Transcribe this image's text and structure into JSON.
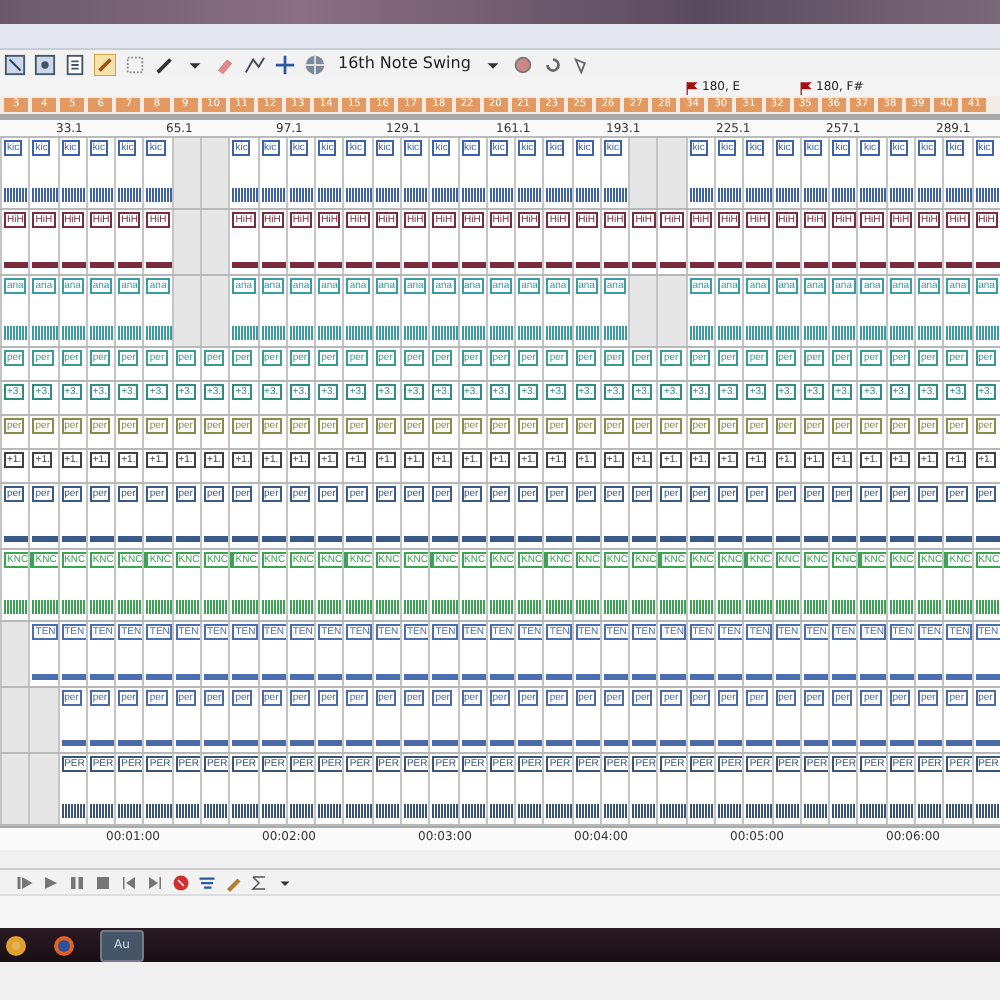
{
  "toolbar": {
    "swing": "16th Note Swing"
  },
  "markers": [
    {
      "label": "180, E"
    },
    {
      "label": "180, F#"
    }
  ],
  "sections": [
    "3",
    "4",
    "5",
    "6",
    "7",
    "8",
    "9",
    "10",
    "11",
    "12",
    "13",
    "14",
    "15",
    "16",
    "17",
    "18",
    "22",
    "20",
    "21",
    "23",
    "25",
    "26",
    "27",
    "28",
    "34",
    "30",
    "31",
    "32",
    "35",
    "36",
    "37",
    "38",
    "39",
    "40",
    "41"
  ],
  "bar_ruler": [
    "33.1",
    "65.1",
    "97.1",
    "129.1",
    "161.1",
    "193.1",
    "225.1",
    "257.1",
    "289.1"
  ],
  "tracks": [
    {
      "kind": "wave",
      "color": "#3d62a8",
      "parts": [
        {
          "clips": [
            "kic",
            "kic",
            "kic",
            "kic",
            "kic",
            "kic"
          ]
        },
        {
          "kind": "gap"
        },
        {
          "kind": "gap"
        },
        {
          "clips": [
            "kic",
            "kic",
            "kic",
            "kic",
            "kic",
            "kic",
            "kic",
            "kic",
            "kic",
            "kic",
            "kic",
            "kic",
            "kic",
            "kic"
          ]
        },
        {
          "kind": "gap"
        },
        {
          "kind": "gap"
        },
        {
          "clips": [
            "kic",
            "kic",
            "kic",
            "kic",
            "kic",
            "kic",
            "kic",
            "kic",
            "kic",
            "kic",
            "kic"
          ]
        }
      ]
    },
    {
      "kind": "line",
      "color": "#7a2c3c",
      "parts": [
        {
          "clips": [
            "HiH",
            "HiH",
            "HiH",
            "HiH",
            "HiH",
            "HiH"
          ]
        },
        {
          "kind": "gap"
        },
        {
          "kind": "gap"
        },
        {
          "clips": [
            "HiH",
            "HiH",
            "HiH",
            "HiH",
            "HiH",
            "HiH",
            "HiH",
            "HiH",
            "HiH",
            "HiH",
            "HiH",
            "HiH",
            "HiH",
            "HiH",
            "HiH",
            "HiH",
            "HiH",
            "HiH",
            "HiH",
            "HiH",
            "HiH",
            "HiH",
            "HiH",
            "HiH",
            "HiH",
            "HiH",
            "HiH"
          ]
        }
      ]
    },
    {
      "kind": "wave",
      "color": "#3a9ca4",
      "parts": [
        {
          "clips": [
            "ana",
            "ana",
            "ana",
            "ana",
            "ana",
            "ana"
          ]
        },
        {
          "kind": "gap"
        },
        {
          "kind": "gap"
        },
        {
          "clips": [
            "ana",
            "ana",
            "ana",
            "ana",
            "ana",
            "ana",
            "ana",
            "ana",
            "ana",
            "ana",
            "ana",
            "ana",
            "ana",
            "ana"
          ]
        },
        {
          "kind": "gap"
        },
        {
          "kind": "gap"
        },
        {
          "clips": [
            "ana",
            "ana",
            "ana",
            "ana",
            "ana",
            "ana",
            "ana",
            "ana",
            "ana",
            "ana",
            "ana"
          ]
        }
      ]
    },
    {
      "kind": "label",
      "color": "#3a9c90",
      "parts": [
        {
          "clips": [
            "per",
            "per",
            "per",
            "per",
            "per",
            "per",
            "per",
            "per",
            "per",
            "per",
            "per",
            "per",
            "per",
            "per",
            "per",
            "per",
            "per",
            "per",
            "per",
            "per",
            "per",
            "per",
            "per",
            "per",
            "per",
            "per",
            "per",
            "per",
            "per",
            "per",
            "per",
            "per",
            "per",
            "per",
            "per"
          ]
        }
      ]
    },
    {
      "kind": "label",
      "color": "#2f8c80",
      "parts": [
        {
          "clips": [
            "+3.",
            "+3.",
            "+3.",
            "+3.",
            "+3.",
            "+3.",
            "+3.",
            "+3.",
            "+3.",
            "+3.",
            "+3.",
            "+3.",
            "+3.",
            "+3.",
            "+3.",
            "+3.",
            "+3.",
            "+3.",
            "+3.",
            "+3.",
            "+3.",
            "+3.",
            "+3.",
            "+3.",
            "+3.",
            "+3.",
            "+3.",
            "+3.",
            "+3.",
            "+3.",
            "+3.",
            "+3.",
            "+3.",
            "+3.",
            "+3."
          ]
        }
      ]
    },
    {
      "kind": "label",
      "color": "#8c8a48",
      "parts": [
        {
          "clips": [
            "per",
            "per",
            "per",
            "per",
            "per",
            "per",
            "per",
            "per",
            "per",
            "per",
            "per",
            "per",
            "per",
            "per",
            "per",
            "per",
            "per",
            "per",
            "per",
            "per",
            "per",
            "per",
            "per",
            "per",
            "per",
            "per",
            "per",
            "per",
            "per",
            "per",
            "per",
            "per",
            "per",
            "per",
            "per"
          ]
        }
      ]
    },
    {
      "kind": "label",
      "color": "#404040",
      "parts": [
        {
          "clips": [
            "+1.",
            "+1.",
            "+1.",
            "+1.",
            "+1.",
            "+1.",
            "+1.",
            "+1.",
            "+1.",
            "+1.",
            "+1.",
            "+1.",
            "+1.",
            "+1.",
            "+1.",
            "+1.",
            "+1.",
            "+1.",
            "+1.",
            "+1.",
            "+1.",
            "+1.",
            "+1.",
            "+1.",
            "+1.",
            "+1.",
            "+1.",
            "+1.",
            "+1.",
            "+1.",
            "+1.",
            "+1.",
            "+1.",
            "+1.",
            "+1."
          ]
        }
      ]
    },
    {
      "kind": "line",
      "color": "#3a5a88",
      "parts": [
        {
          "clips": [
            "per",
            "per",
            "per",
            "per",
            "per",
            "per",
            "per",
            "per",
            "per",
            "per",
            "per",
            "per",
            "per",
            "per",
            "per",
            "per",
            "per",
            "per",
            "per",
            "per",
            "per",
            "per",
            "per",
            "per",
            "per",
            "per",
            "per",
            "per",
            "per",
            "per",
            "per",
            "per",
            "per",
            "per",
            "per"
          ]
        }
      ]
    },
    {
      "kind": "wave",
      "color": "#3aa452",
      "parts": [
        {
          "clips": [
            "KNC",
            "KNC",
            "KNC",
            "KNC",
            "KNC",
            "KNC",
            "KNC",
            "KNC",
            "KNC",
            "KNC",
            "KNC",
            "KNC",
            "KNC",
            "KNC",
            "KNC",
            "KNC",
            "KNC",
            "KNC",
            "KNC",
            "KNC",
            "KNC",
            "KNC",
            "KNC",
            "KNC",
            "KNC",
            "KNC",
            "KNC",
            "KNC",
            "KNC",
            "KNC",
            "KNC",
            "KNC",
            "KNC",
            "KNC",
            "KNC"
          ]
        }
      ]
    },
    {
      "kind": "line",
      "color": "#4a6eb0",
      "parts": [
        {
          "kind": "gap"
        },
        {
          "clips": [
            "TEN",
            "TEN",
            "TEN",
            "TEN",
            "TEN",
            "TEN",
            "TEN",
            "TEN",
            "TEN",
            "TEN",
            "TEN",
            "TEN",
            "TEN",
            "TEN",
            "TEN",
            "TEN",
            "TEN",
            "TEN",
            "TEN",
            "TEN",
            "TEN",
            "TEN",
            "TEN",
            "TEN",
            "TEN",
            "TEN",
            "TEN",
            "TEN",
            "TEN",
            "TEN",
            "TEN",
            "TEN",
            "TEN",
            "TEN"
          ]
        }
      ]
    },
    {
      "kind": "line",
      "color": "#4a6aa8",
      "parts": [
        {
          "kind": "gap"
        },
        {
          "kind": "gap"
        },
        {
          "clips": [
            "per",
            "per",
            "per",
            "per",
            "per",
            "per",
            "per",
            "per",
            "per",
            "per",
            "per",
            "per",
            "per",
            "per",
            "per",
            "per",
            "per",
            "per",
            "per",
            "per",
            "per",
            "per",
            "per",
            "per",
            "per",
            "per",
            "per",
            "per",
            "per",
            "per",
            "per",
            "per",
            "per"
          ]
        }
      ]
    },
    {
      "kind": "wave",
      "color": "#3a5478",
      "parts": [
        {
          "kind": "gap"
        },
        {
          "kind": "gap"
        },
        {
          "clips": [
            "PER",
            "PER",
            "PER",
            "PER",
            "PER",
            "PER",
            "PER",
            "PER",
            "PER",
            "PER",
            "PER",
            "PER",
            "PER",
            "PER",
            "PER",
            "PER",
            "PER",
            "PER",
            "PER",
            "PER",
            "PER",
            "PER",
            "PER",
            "PER",
            "PER",
            "PER",
            "PER",
            "PER",
            "PER",
            "PER",
            "PER",
            "PER",
            "PER"
          ]
        }
      ]
    }
  ],
  "time_ruler": [
    "00:01:00",
    "00:02:00",
    "00:03:00",
    "00:04:00",
    "00:05:00",
    "00:06:00"
  ],
  "taskbar": {
    "app": "Au"
  }
}
